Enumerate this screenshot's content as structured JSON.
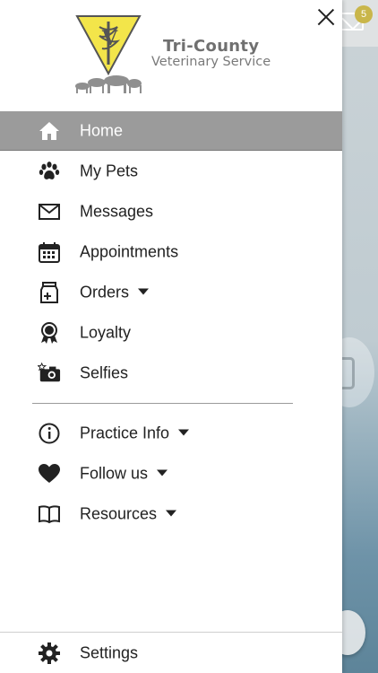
{
  "background": {
    "badge_count": "5",
    "colors": {
      "header": "#dfe2e3",
      "badge": "#c9b64a"
    }
  },
  "drawer": {
    "close_icon": "close-icon",
    "logo": {
      "title": "Tri-County",
      "subtitle": "Veterinary Service"
    },
    "menu": [
      {
        "id": "home",
        "label": "Home",
        "icon": "home-icon",
        "active": true,
        "has_caret": false
      },
      {
        "id": "my-pets",
        "label": "My Pets",
        "icon": "paw-icon",
        "active": false,
        "has_caret": false
      },
      {
        "id": "messages",
        "label": "Messages",
        "icon": "envelope-icon",
        "active": false,
        "has_caret": false
      },
      {
        "id": "appointments",
        "label": "Appointments",
        "icon": "calendar-icon",
        "active": false,
        "has_caret": false
      },
      {
        "id": "orders",
        "label": "Orders",
        "icon": "medicine-bag-icon",
        "active": false,
        "has_caret": true
      },
      {
        "id": "loyalty",
        "label": "Loyalty",
        "icon": "award-ribbon-icon",
        "active": false,
        "has_caret": false
      },
      {
        "id": "selfies",
        "label": "Selfies",
        "icon": "camera-icon",
        "active": false,
        "has_caret": false
      }
    ],
    "secondary_menu": [
      {
        "id": "practice-info",
        "label": "Practice Info",
        "icon": "info-icon",
        "has_caret": true
      },
      {
        "id": "follow-us",
        "label": "Follow us",
        "icon": "heart-icon",
        "has_caret": true
      },
      {
        "id": "resources",
        "label": "Resources",
        "icon": "book-icon",
        "has_caret": true
      }
    ],
    "settings": {
      "label": "Settings",
      "icon": "gear-icon"
    },
    "colors": {
      "active_bg": "#9b9b9b",
      "text": "#222222",
      "logo_yellow": "#f3e54a"
    }
  }
}
